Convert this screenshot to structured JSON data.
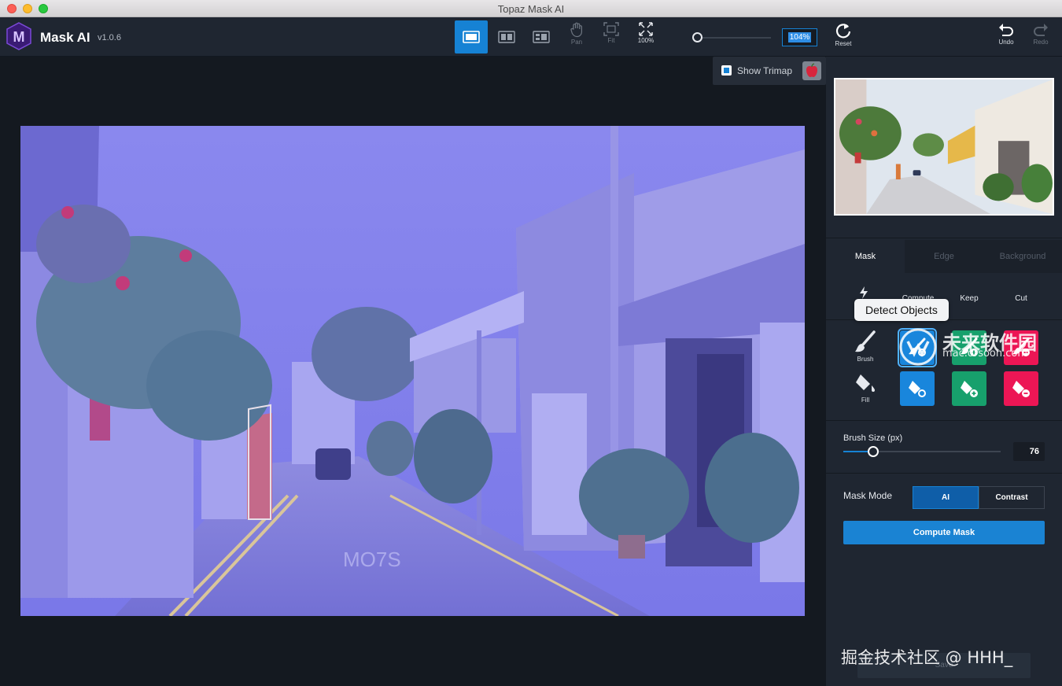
{
  "window": {
    "title": "Topaz Mask AI"
  },
  "app": {
    "name": "Mask AI",
    "version": "v1.0.6",
    "logo_letter": "M"
  },
  "toolbar": {
    "view_modes": [
      "single-view-icon",
      "split-view-icon",
      "side-by-side-icon"
    ],
    "pan_label": "Pan",
    "fit_label": "Fit",
    "zoom100_label": "100%",
    "zoom_value": "104%",
    "reset_label": "Reset",
    "undo_label": "Undo",
    "redo_label": "Redo"
  },
  "canvas": {
    "show_trimap_label": "Show Trimap",
    "show_trimap_checked": true
  },
  "panel": {
    "tabs": [
      {
        "label": "Mask",
        "active": true
      },
      {
        "label": "Edge",
        "active": false
      },
      {
        "label": "Background",
        "active": false
      }
    ],
    "actions": {
      "compute": "Compute",
      "keep": "Keep",
      "cut": "Cut"
    },
    "tooltip": "Detect Objects",
    "tool_rows": {
      "brush_label": "Brush",
      "fill_label": "Fill"
    },
    "brush_size": {
      "label": "Brush Size (px)",
      "value": "76",
      "fraction": 0.19
    },
    "mask_mode": {
      "label": "Mask Mode",
      "options": [
        "AI",
        "Contrast"
      ],
      "selected": "AI"
    },
    "compute_mask_label": "Compute Mask",
    "save_label": "Save"
  },
  "watermarks": {
    "site_cn": "未来软件园",
    "site_url": "mac.orsoon.com",
    "footer": "掘金技术社区 @ HHH_"
  },
  "colors": {
    "accent_blue": "#1682d4",
    "keep_green": "#17a06c",
    "cut_red": "#ec1655",
    "mask_overlay": "#7b78ff"
  }
}
